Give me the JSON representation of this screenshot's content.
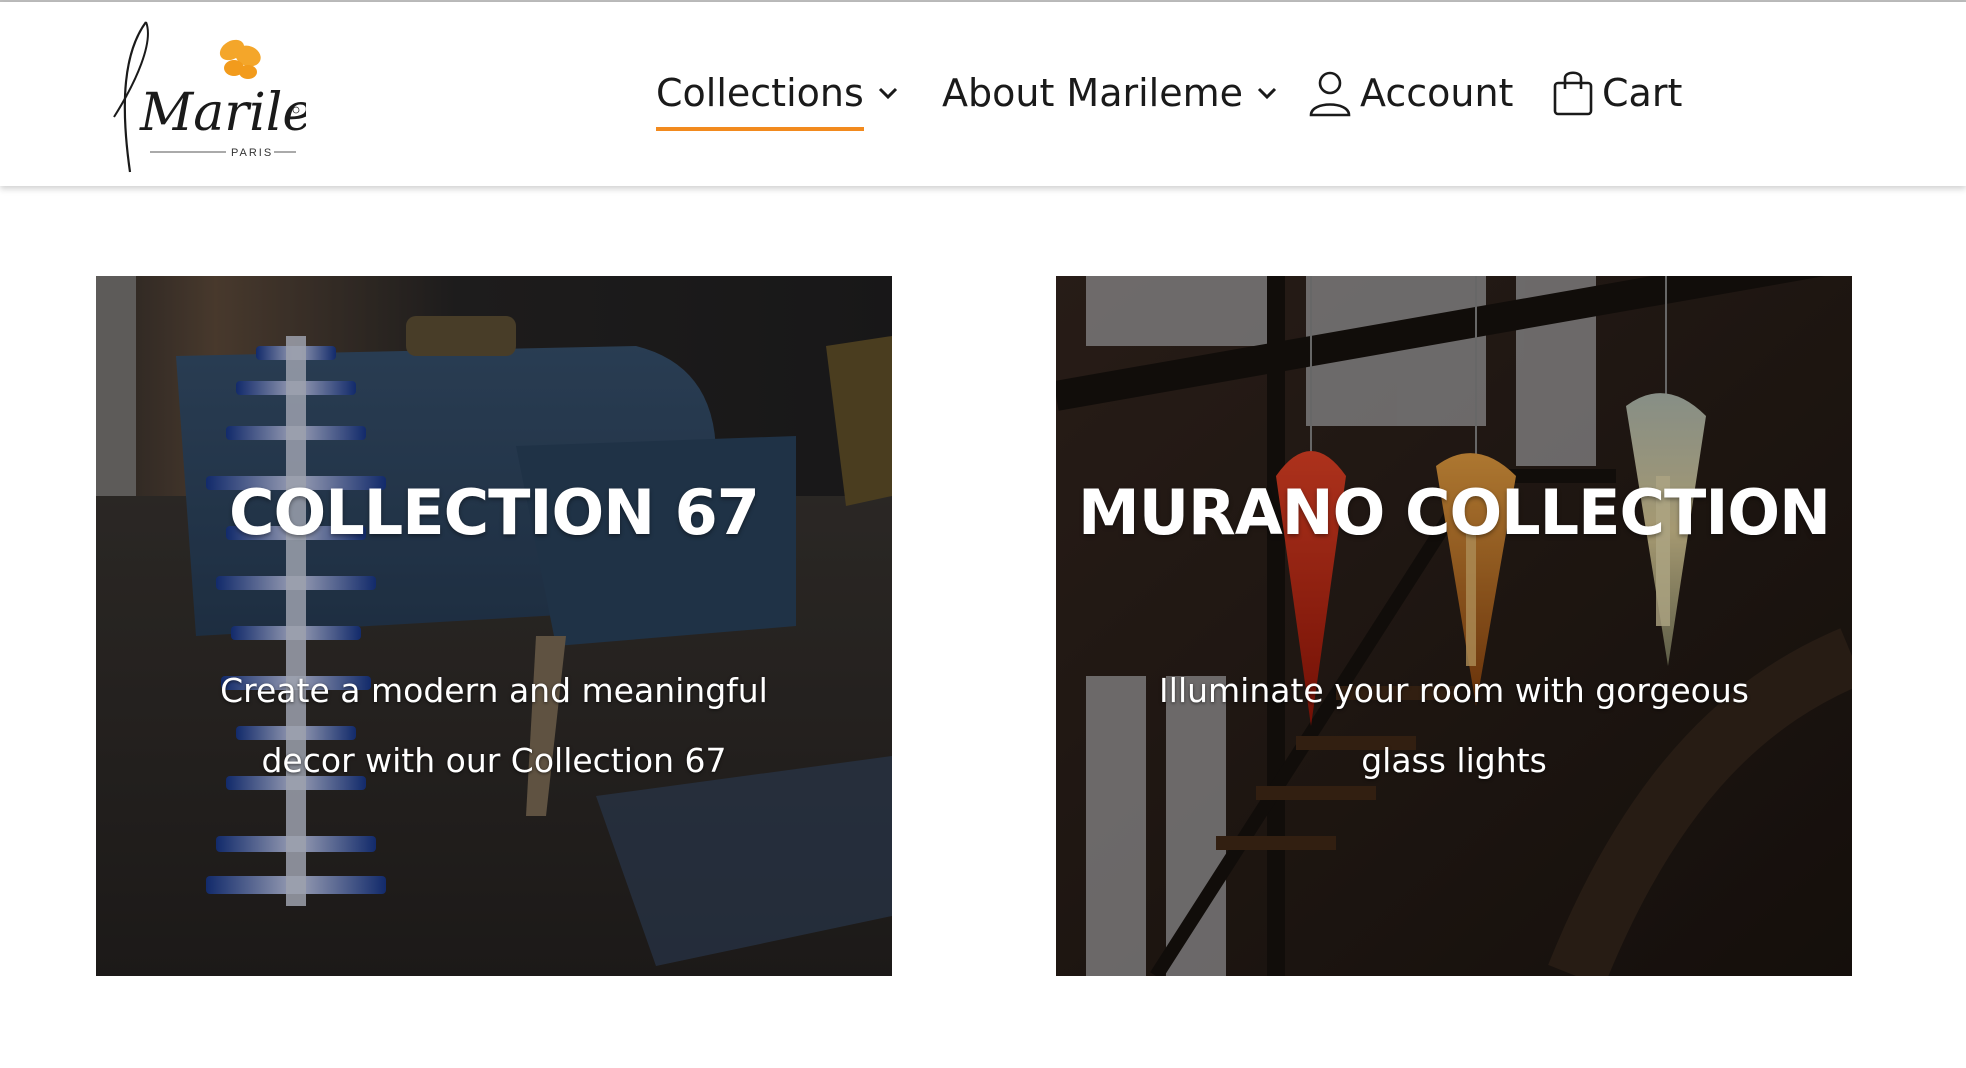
{
  "brand": {
    "logo_text": "Marileme",
    "logo_subtext": "PARIS",
    "accent_color": "#f28a1e"
  },
  "nav": {
    "collections": "Collections",
    "about": "About Marileme",
    "account": "Account",
    "cart": "Cart"
  },
  "cards": [
    {
      "title": "COLLECTION 67",
      "subtitle": "Create a modern and meaningful decor with our Collection 67"
    },
    {
      "title": "MURANO COLLECTION",
      "subtitle": "Illuminate your room with gorgeous glass lights"
    }
  ],
  "icons": [
    "chevron-down-icon",
    "user-icon",
    "shopping-bag-icon",
    "butterfly-icon"
  ]
}
